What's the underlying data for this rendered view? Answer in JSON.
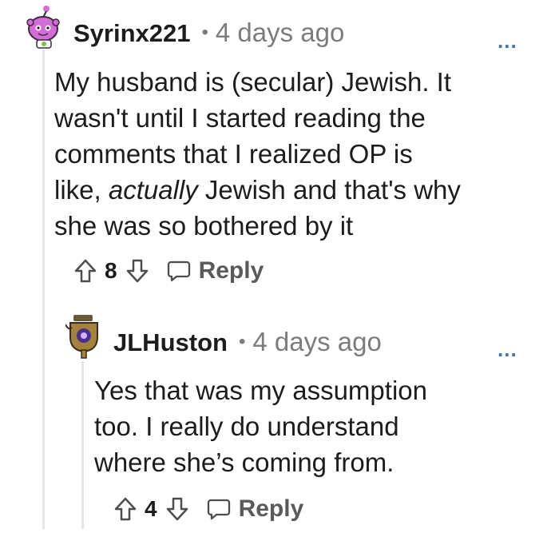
{
  "comments": [
    {
      "username": "Syrinx221",
      "separator": "•",
      "time": "4 days ago",
      "more": "...",
      "body_lines": [
        "My husband is (secular) Jewish. It",
        "wasn't until I started reading the",
        "comments that I realized OP is"
      ],
      "body_line4_pre": "like, ",
      "body_line4_em": "actually",
      "body_line4_post": " Jewish and that's why",
      "body_line5": "she was so bothered by it",
      "votes": "8",
      "reply_label": "Reply"
    },
    {
      "username": "JLHuston",
      "separator": "•",
      "time": "4 days ago",
      "more": "...",
      "body_lines": [
        "Yes that was my assumption",
        "too. I really do understand",
        "where she’s coming from."
      ],
      "votes": "4",
      "reply_label": "Reply"
    }
  ],
  "icons": {
    "avatar1": "snoo-avatar-icon",
    "avatar2": "trophy-avatar-icon",
    "upvote": "upvote-arrow-icon",
    "downvote": "downvote-arrow-icon",
    "reply": "speech-bubble-icon"
  },
  "colors": {
    "link_blue": "#3a76c4",
    "meta_gray": "#7c7c7c",
    "thread_line": "#e6e6e6"
  }
}
